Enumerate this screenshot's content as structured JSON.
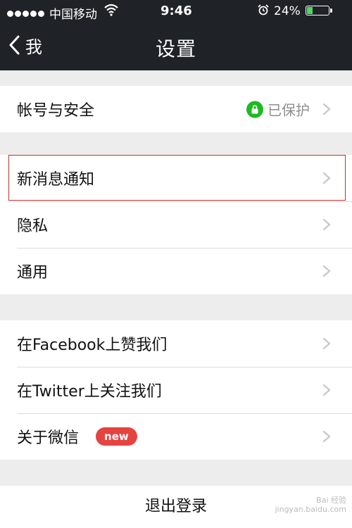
{
  "status_bar": {
    "carrier": "中国移动",
    "time": "9:46",
    "battery_percent": "24%",
    "battery_level": 0.24,
    "signal_bars": 5
  },
  "nav": {
    "back_label": "我",
    "title": "设置"
  },
  "groups": [
    {
      "items": [
        {
          "label": "帐号与安全",
          "status": "已保护",
          "status_icon": "lock-icon"
        }
      ]
    },
    {
      "items": [
        {
          "label": "新消息通知",
          "highlighted": true
        },
        {
          "label": "隐私"
        },
        {
          "label": "通用"
        }
      ]
    },
    {
      "items": [
        {
          "label": "在Facebook上赞我们"
        },
        {
          "label": "在Twitter上关注我们"
        },
        {
          "label": "关于微信",
          "badge": "new"
        }
      ]
    }
  ],
  "logout_label": "退出登录",
  "watermark": {
    "line1": "Bai 经验",
    "line2": "jingyan.baidu.com"
  },
  "colors": {
    "navbar_bg": "#1f2226",
    "background": "#ededed",
    "lock_green": "#1fb922",
    "badge_red": "#e64340",
    "highlight_red": "#c8312e"
  }
}
